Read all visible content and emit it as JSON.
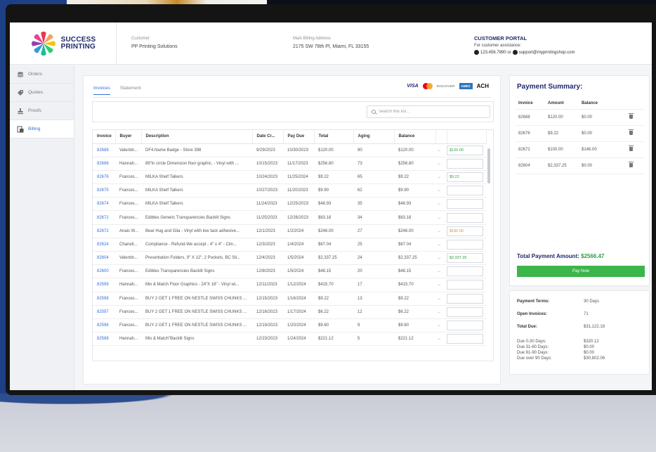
{
  "header": {
    "logo_line1": "SUCCESS",
    "logo_line2": "PRINTING",
    "customer_label": "Customer",
    "customer_value": "PP Printing Solutions",
    "billing_label": "Main Billing Address",
    "billing_value": "2175 SW 78th Pl, Miami, FL 33155",
    "portal_title": "CUSTOMER PORTAL",
    "portal_assist": "For customer assistance:",
    "portal_contact": "123.456.7890 or",
    "portal_email": "support@myprintingshop.com"
  },
  "sidebar": {
    "items": [
      {
        "label": "Orders"
      },
      {
        "label": "Quotes"
      },
      {
        "label": "Proofs"
      },
      {
        "label": "Billing"
      }
    ]
  },
  "tabs": [
    {
      "label": "Invoices"
    },
    {
      "label": "Statement"
    }
  ],
  "payment_logos": {
    "visa": "VISA",
    "discover": "DISCOVER",
    "amex": "AMEX",
    "ach": "ACH"
  },
  "search": {
    "placeholder": "Search this list..."
  },
  "table": {
    "columns": [
      "Invoice",
      "Buyer",
      "Description",
      "Date Cr...",
      "Pay Due",
      "Total",
      "Aging",
      "Balance"
    ],
    "rows": [
      {
        "invoice": "82688",
        "buyer": "Valentin...",
        "description": "DF4.Name Badge - Store 398",
        "date": "9/29/2023",
        "due": "10/30/2023",
        "total": "$120.00",
        "aging": "90",
        "balance": "$120.00",
        "arrow": "→",
        "pay": "$120.00",
        "pay_color": "green"
      },
      {
        "invoice": "82686",
        "buyer": "Hannah...",
        "description": "89\"in circle Dimension floor graphic. - Vinyl with ...",
        "date": "10/15/2023",
        "due": "11/17/2023",
        "total": "$256.80",
        "aging": "73",
        "balance": "$256.80",
        "arrow": "→",
        "pay": "",
        "pay_color": ""
      },
      {
        "invoice": "82676",
        "buyer": "Frances...",
        "description": "MILKA Shelf Talkers",
        "date": "10/24/2023",
        "due": "11/25/2024",
        "total": "$9.22",
        "aging": "65",
        "balance": "$9.22",
        "arrow": "→",
        "pay": "$9.22",
        "pay_color": "green"
      },
      {
        "invoice": "82675",
        "buyer": "Frances...",
        "description": "MILKA Shelf Talkers",
        "date": "10/27/2023",
        "due": "11/20/2023",
        "total": "$9.90",
        "aging": "62",
        "balance": "$9.90",
        "arrow": "→",
        "pay": "",
        "pay_color": ""
      },
      {
        "invoice": "82674",
        "buyer": "Frances...",
        "description": "MILKA Shelf Talkers",
        "date": "11/24/2023",
        "due": "12/25/2023",
        "total": "$48.93",
        "aging": "35",
        "balance": "$48.93",
        "arrow": "→",
        "pay": "",
        "pay_color": ""
      },
      {
        "invoice": "82672",
        "buyer": "Frances...",
        "description": "Edibles Generic Transparencies Backlit Signs",
        "date": "11/25/2023",
        "due": "12/26/2023",
        "total": "$63.18",
        "aging": "34",
        "balance": "$63.18",
        "arrow": "→",
        "pay": "",
        "pay_color": ""
      },
      {
        "invoice": "82672",
        "buyer": "Anais W...",
        "description": "Bear Hug and Gila - Vinyl with low tack adhesive...",
        "date": "12/1/2023",
        "due": "1/2/2024",
        "total": "$246.00",
        "aging": "27",
        "balance": "$246.00",
        "arrow": "→",
        "pay": "$100.00",
        "pay_color": "orange"
      },
      {
        "invoice": "82624",
        "buyer": "Chanell...",
        "description": "Compliance - Refund-We accept - 4\" x 4\" - Clin...",
        "date": "12/3/2023",
        "due": "1/4/2024",
        "total": "$67.04",
        "aging": "25",
        "balance": "$67.04",
        "arrow": "→",
        "pay": "",
        "pay_color": ""
      },
      {
        "invoice": "82604",
        "buyer": "Valentin...",
        "description": "Presentation Folders, 9\" X 12\", 2 Pockets, BC Sli...",
        "date": "12/4/2023",
        "due": "1/5/2024",
        "total": "$2,337.25",
        "aging": "24",
        "balance": "$2,337.25",
        "arrow": "→",
        "pay": "$2,337.25",
        "pay_color": "green"
      },
      {
        "invoice": "82600",
        "buyer": "Frances...",
        "description": "Edibles Transparencies Backlit Signs",
        "date": "12/8/2023",
        "due": "1/5/2024",
        "total": "$48.15",
        "aging": "20",
        "balance": "$48.15",
        "arrow": "→",
        "pay": "",
        "pay_color": ""
      },
      {
        "invoice": "82599",
        "buyer": "Hannah...",
        "description": "Mix & Match Floor Graphics - 24\"X 18\" - Vinyl wi...",
        "date": "12/11/2023",
        "due": "1/12/2024",
        "total": "$415.70",
        "aging": "17",
        "balance": "$415.70",
        "arrow": "→",
        "pay": "",
        "pay_color": ""
      },
      {
        "invoice": "82598",
        "buyer": "Frances...",
        "description": "BUY 2 GET 1 FREE ON NESTLE SWISS CHUNKS ...",
        "date": "12/15/2023",
        "due": "1/16/2024",
        "total": "$9.22",
        "aging": "13",
        "balance": "$9.22",
        "arrow": "→",
        "pay": "",
        "pay_color": ""
      },
      {
        "invoice": "82597",
        "buyer": "Frances...",
        "description": "BUY 2 GET 1 FREE ON NESTLE SWISS CHUNKS ...",
        "date": "12/16/2023",
        "due": "1/17/2024",
        "total": "$6.22",
        "aging": "12",
        "balance": "$6.22",
        "arrow": "→",
        "pay": "",
        "pay_color": ""
      },
      {
        "invoice": "82596",
        "buyer": "Frances...",
        "description": "BUY 2 GET 1 FREE ON NESTLE SWISS CHUNKS ...",
        "date": "12/19/2023",
        "due": "1/20/2024",
        "total": "$9.60",
        "aging": "9",
        "balance": "$9.60",
        "arrow": "→",
        "pay": "",
        "pay_color": ""
      },
      {
        "invoice": "82588",
        "buyer": "Hannah...",
        "description": "Mix & Match\"Backlit Signs",
        "date": "12/23/2023",
        "due": "1/24/2024",
        "total": "$221.12",
        "aging": "5",
        "balance": "$221.12",
        "arrow": "→",
        "pay": "",
        "pay_color": ""
      }
    ]
  },
  "summary": {
    "title": "Payment Summary:",
    "columns": [
      "Invoice",
      "Amount",
      "Balance"
    ],
    "rows": [
      {
        "invoice": "82688",
        "amount": "$120.00",
        "balance": "$0.00"
      },
      {
        "invoice": "82676",
        "amount": "$9.22",
        "balance": "$0.00"
      },
      {
        "invoice": "82672",
        "amount": "$100.00",
        "balance": "$146.00"
      },
      {
        "invoice": "82604",
        "amount": "$2,337.25",
        "balance": "$0.00"
      }
    ],
    "total_label": "Total Payment Amount:",
    "total_value": "$2566.47",
    "pay_button": "Pay Now"
  },
  "terms": {
    "payment_terms_label": "Payment Terms:",
    "payment_terms_value": "30 Days",
    "open_invoices_label": "Open Invoices:",
    "open_invoices_value": "71",
    "total_due_label": "Total Due:",
    "total_due_value": "$31,122.18",
    "aging": [
      {
        "label": "Due 0-30 Days:",
        "value": "$320.12"
      },
      {
        "label": "Due 31-60 Days:",
        "value": "$0.00"
      },
      {
        "label": "Due 61-90 Days:",
        "value": "$0.00"
      },
      {
        "label": "Due over 90 Days:",
        "value": "$30,802.06"
      }
    ]
  },
  "colors": {
    "accent": "#3a6fd8",
    "brand": "#1f2a6b",
    "green": "#3cb54a",
    "orange": "#e08a1e",
    "backdrop": "#1d3f86"
  }
}
